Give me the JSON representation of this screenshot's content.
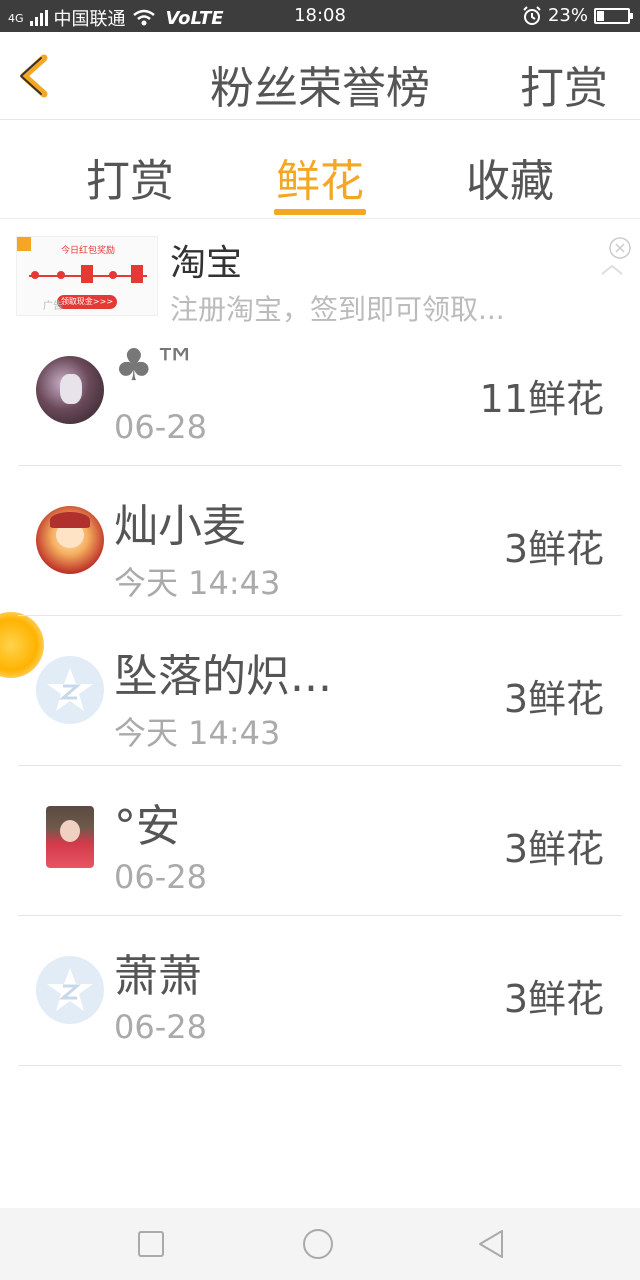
{
  "status_bar": {
    "network": "4G",
    "carrier": "中国联通",
    "volte": "VoLTE",
    "time": "18:08",
    "battery_percent": "23%",
    "battery_level": 0.23
  },
  "header": {
    "title": "粉丝荣誉榜",
    "right_button": "打赏"
  },
  "tabs": [
    {
      "label": "打赏"
    },
    {
      "label": "鲜花",
      "active": true
    },
    {
      "label": "收藏"
    }
  ],
  "ad": {
    "title": "淘宝",
    "description": "注册淘宝，签到即可领取...",
    "image_heading": "今日红包奖励",
    "image_button": "领取现金>>>",
    "badge": "广告"
  },
  "fans": [
    {
      "name": "♣™",
      "time": "06-28",
      "count": "11鲜花"
    },
    {
      "name": "灿小麦",
      "time": "今天 14:43",
      "count": "3鲜花"
    },
    {
      "name": "坠落的炽...",
      "time": "今天 14:43",
      "count": "3鲜花"
    },
    {
      "name": "°安",
      "time": "06-28",
      "count": "3鲜花"
    },
    {
      "name": "萧萧",
      "time": "06-28",
      "count": "3鲜花"
    }
  ],
  "colors": {
    "accent": "#f5a623",
    "status_bar": "#3d3d3d",
    "divider": "#e6e6e6"
  },
  "icons": {
    "back": "back-chevron-icon",
    "ad_close": "close-icon",
    "nav_recents": "square-icon",
    "nav_home": "circle-icon",
    "nav_back": "triangle-back-icon"
  }
}
